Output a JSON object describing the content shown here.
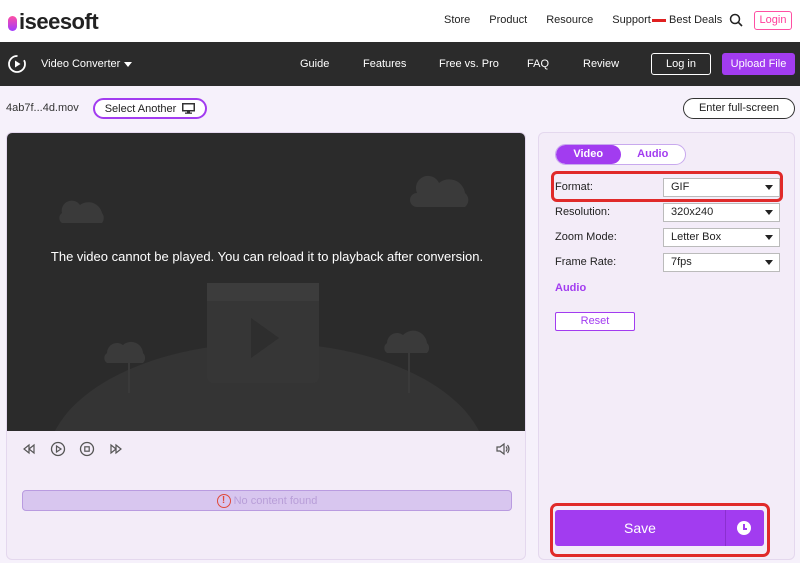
{
  "brand": {
    "logo_text": "iseesoft"
  },
  "topnav": {
    "items": [
      "Store",
      "Product",
      "Resource",
      "Support"
    ],
    "deals": "Best Deals",
    "login": "Login"
  },
  "appbar": {
    "app_name": "Video Converter",
    "nav": [
      "Guide",
      "Features",
      "Free vs. Pro",
      "FAQ",
      "Review"
    ],
    "login": "Log in",
    "upload": "Upload File"
  },
  "file": {
    "name": "4ab7f...4d.mov",
    "select_another": "Select Another",
    "fullscreen": "Enter full-screen"
  },
  "player": {
    "message": "The video cannot be played. You can reload it to playback after conversion.",
    "progress_text": "No content found"
  },
  "settings": {
    "tabs": {
      "video": "Video",
      "audio": "Audio",
      "active": "Video"
    },
    "format": {
      "label": "Format:",
      "value": "GIF"
    },
    "resolution": {
      "label": "Resolution:",
      "value": "320x240"
    },
    "zoom": {
      "label": "Zoom Mode:",
      "value": "Letter Box"
    },
    "framerate": {
      "label": "Frame Rate:",
      "value": "7fps"
    },
    "audio_link": "Audio",
    "reset": "Reset",
    "save": "Save"
  },
  "colors": {
    "accent": "#a23cf0",
    "highlight": "#e02a2a",
    "dark": "#2b2b2b"
  }
}
